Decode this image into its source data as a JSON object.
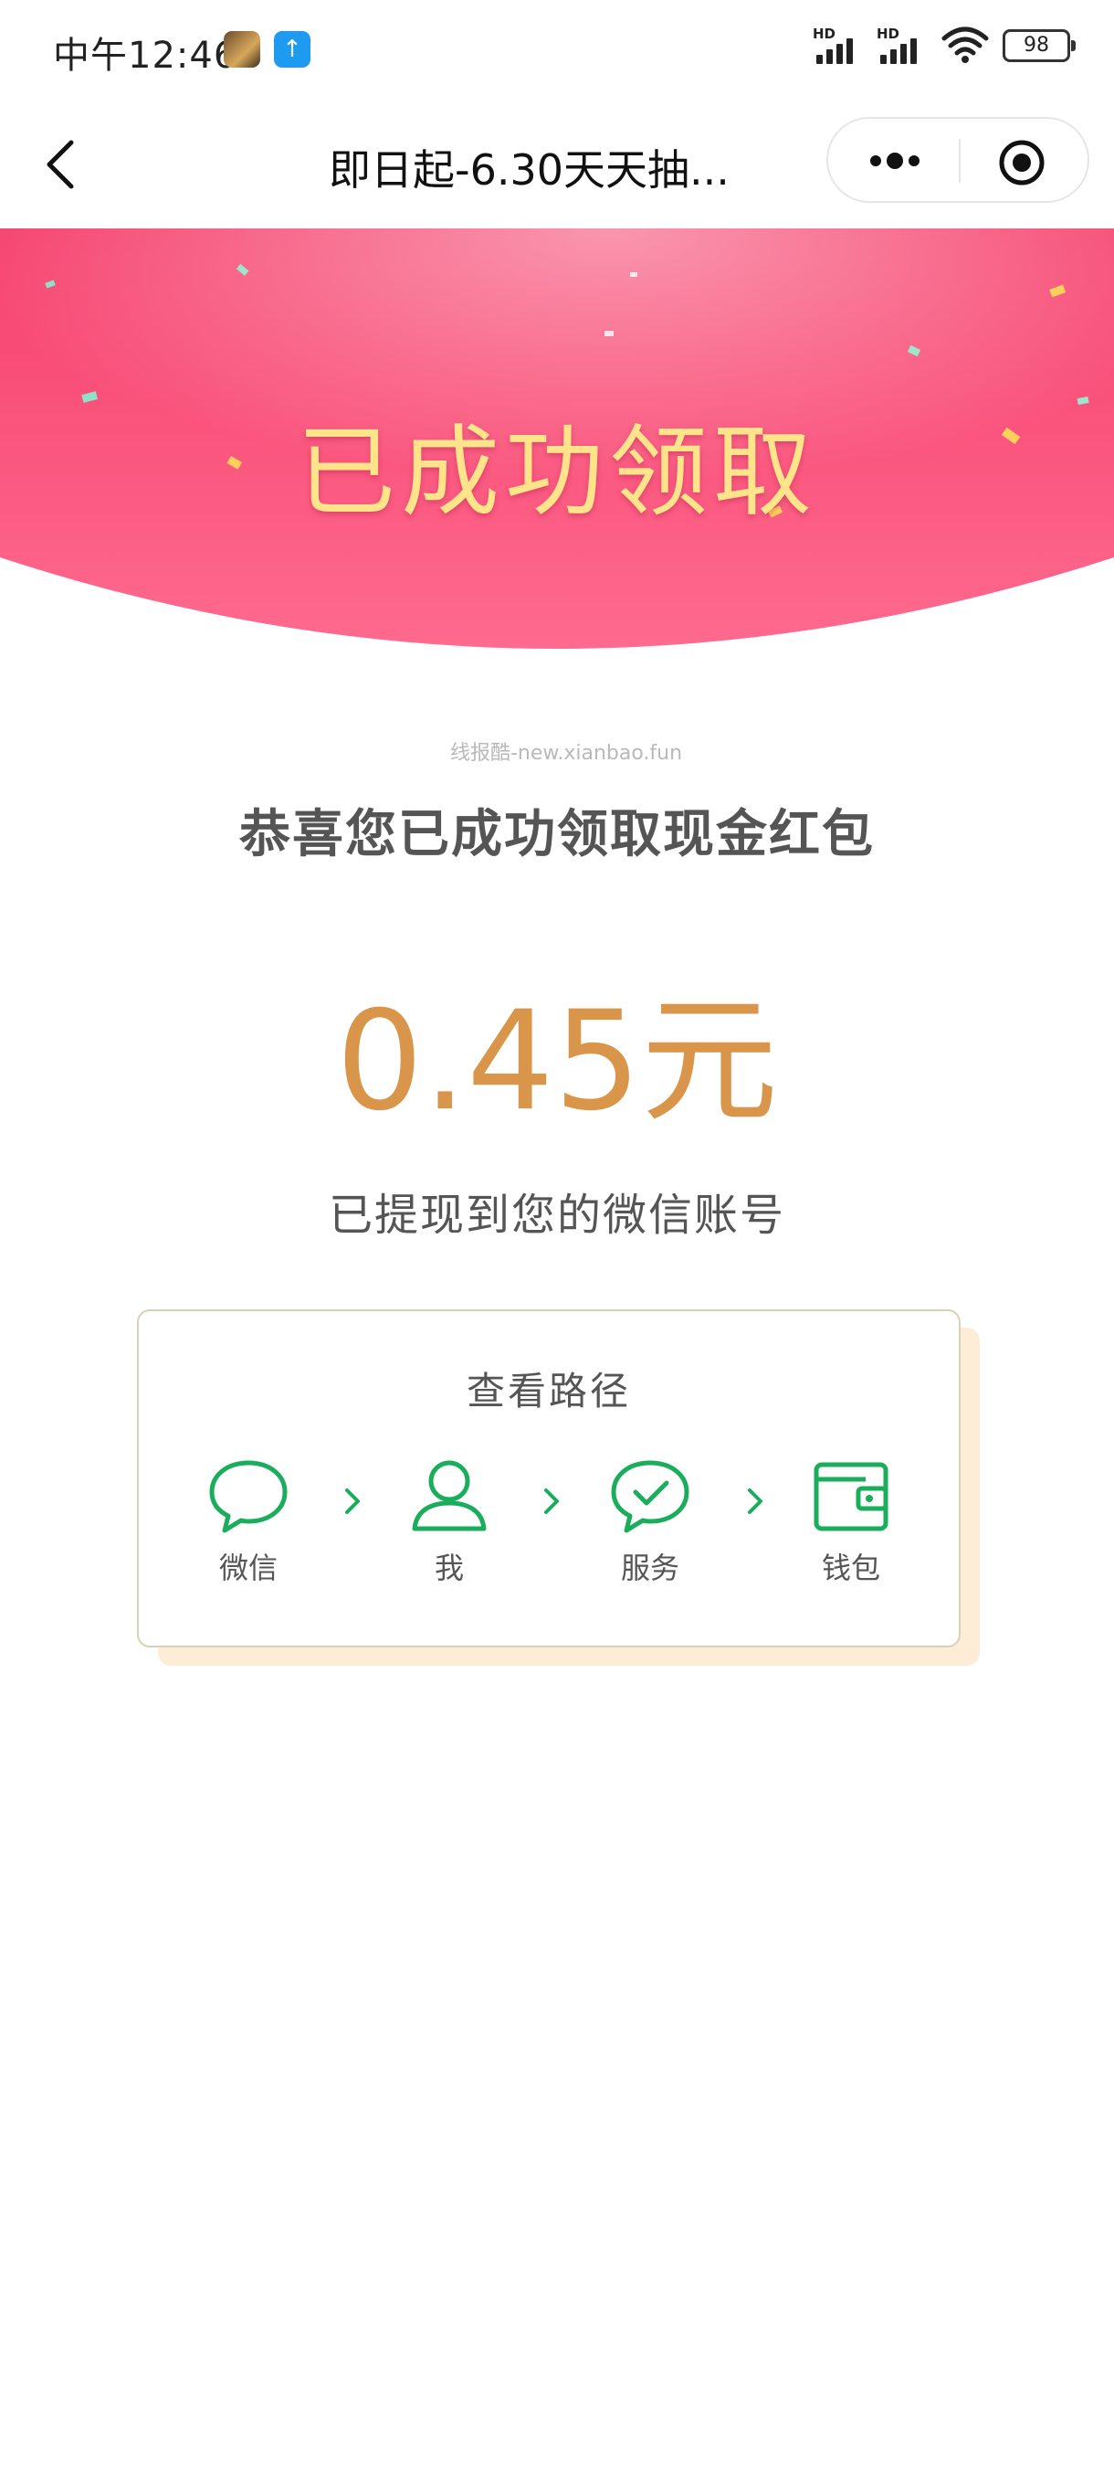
{
  "status_bar": {
    "time": "中午12:46",
    "signal_labels": [
      "HD",
      "HD"
    ],
    "battery": "98"
  },
  "nav": {
    "title": "即日起-6.30天天抽..."
  },
  "banner": {
    "title": "已成功领取"
  },
  "watermark": "线报酷-new.xianbao.fun",
  "result": {
    "congrats": "恭喜您已成功领取现金红包",
    "amount": "0.45元",
    "withdrawn": "已提现到您的微信账号"
  },
  "path_card": {
    "title": "查看路径",
    "steps": [
      {
        "label": "微信",
        "icon": "chat-bubble-icon"
      },
      {
        "label": "我",
        "icon": "person-icon"
      },
      {
        "label": "服务",
        "icon": "check-bubble-icon"
      },
      {
        "label": "钱包",
        "icon": "wallet-icon"
      }
    ]
  },
  "colors": {
    "banner_pink": "#f5426f",
    "banner_title": "#ffe48a",
    "amount": "#d9954a",
    "wechat_green": "#1aad5c",
    "card_border": "#d8d1b9",
    "card_shadow": "#fdecd6"
  }
}
